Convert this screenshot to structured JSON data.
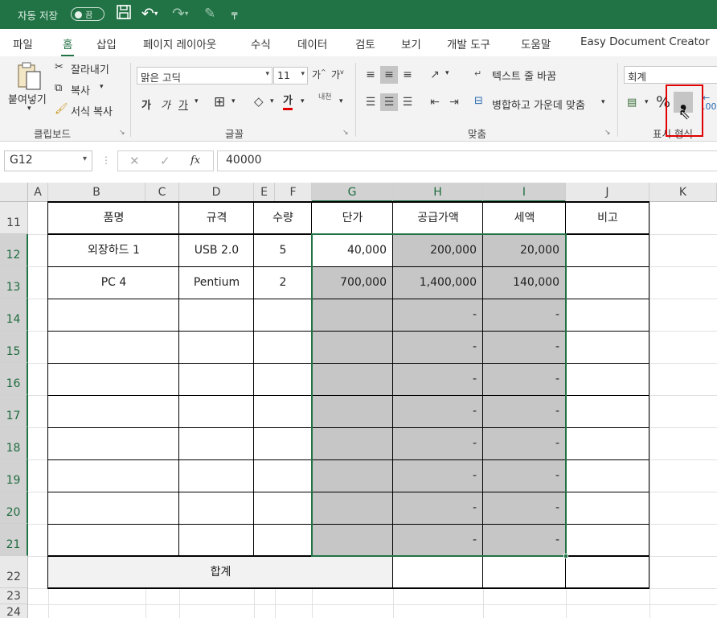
{
  "titlebar": {
    "autosave_label": "자동 저장",
    "toggle_state": "끔"
  },
  "menu": {
    "tabs": [
      "파일",
      "홈",
      "삽입",
      "페이지 레이아웃",
      "수식",
      "데이터",
      "검토",
      "보기",
      "개발 도구",
      "도움말",
      "Easy Document Creator"
    ],
    "active_tab": "홈"
  },
  "ribbon": {
    "clipboard": {
      "paste": "붙여넣기",
      "cut": "잘라내기",
      "copy": "복사",
      "format_painter": "서식 복사",
      "group_label": "클립보드"
    },
    "font": {
      "font_name": "맑은 고딕",
      "font_size": "11",
      "bold": "가",
      "italic": "가",
      "underline": "가",
      "font_color_glyph": "가",
      "phonetic": "내천",
      "group_label": "글꼴"
    },
    "alignment": {
      "wrap_text": "텍스트 줄 바꿈",
      "merge_center": "병합하고 가운데 맞춤",
      "group_label": "맞춤"
    },
    "number": {
      "format": "회계",
      "percent": "%",
      "comma": "❟",
      "group_label": "표시 형식"
    },
    "accent_color": "#217346",
    "highlight_color": "#e00000"
  },
  "formula_bar": {
    "name_box": "G12",
    "fx": "fx",
    "value": "40000"
  },
  "sheet": {
    "columns": [
      "A",
      "B",
      "C",
      "D",
      "E",
      "F",
      "G",
      "H",
      "I",
      "J",
      "K"
    ],
    "rows": [
      "11",
      "12",
      "13",
      "14",
      "15",
      "16",
      "17",
      "18",
      "19",
      "20",
      "21",
      "22",
      "23",
      "24"
    ],
    "headers": {
      "item": "품명",
      "spec": "규격",
      "qty": "수량",
      "unit_price": "단가",
      "supply": "공급가액",
      "tax": "세액",
      "note": "비고"
    },
    "data_rows": [
      {
        "item": "외장하드 1",
        "spec": "USB 2.0",
        "qty": "5",
        "unit_price": "40,000",
        "supply": "200,000",
        "tax": "20,000"
      },
      {
        "item": "PC 4",
        "spec": "Pentium",
        "qty": "2",
        "unit_price": "700,000",
        "supply": "1,400,000",
        "tax": "140,000"
      }
    ],
    "dash": "-",
    "total_label": "합계"
  }
}
